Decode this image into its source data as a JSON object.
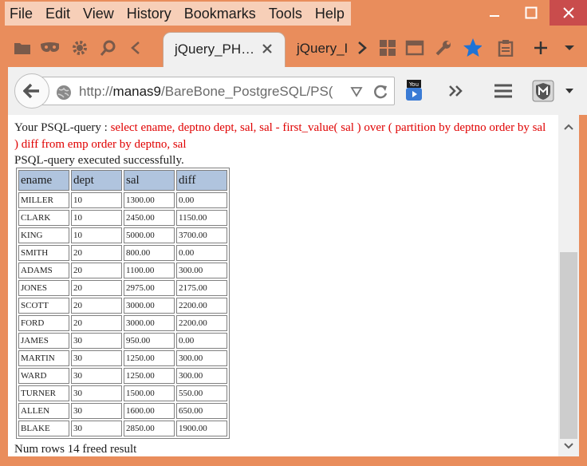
{
  "menu": {
    "items": [
      "File",
      "Edit",
      "View",
      "History",
      "Bookmarks",
      "Tools",
      "Help"
    ]
  },
  "tabs": {
    "active_title": "jQuery_PH…",
    "inactive_title": "jQuery_I"
  },
  "navbar": {
    "url_prefix": "http://",
    "url_host": "manas9",
    "url_path": "/BareBone_PostgreSQL/PS("
  },
  "content": {
    "query_label": "Your PSQL-query : ",
    "query_sql": "select ename, deptno dept, sal, sal - first_value( sal ) over ( partition by deptno order by sal ) diff from emp order by deptno, sal",
    "status": "PSQL-query executed successfully.",
    "table": {
      "headers": [
        "ename",
        "dept",
        "sal",
        "diff"
      ],
      "rows": [
        [
          "MILLER",
          "10",
          "1300.00",
          "0.00"
        ],
        [
          "CLARK",
          "10",
          "2450.00",
          "1150.00"
        ],
        [
          "KING",
          "10",
          "5000.00",
          "3700.00"
        ],
        [
          "SMITH",
          "20",
          "800.00",
          "0.00"
        ],
        [
          "ADAMS",
          "20",
          "1100.00",
          "300.00"
        ],
        [
          "JONES",
          "20",
          "2975.00",
          "2175.00"
        ],
        [
          "SCOTT",
          "20",
          "3000.00",
          "2200.00"
        ],
        [
          "FORD",
          "20",
          "3000.00",
          "2200.00"
        ],
        [
          "JAMES",
          "30",
          "950.00",
          "0.00"
        ],
        [
          "MARTIN",
          "30",
          "1250.00",
          "300.00"
        ],
        [
          "WARD",
          "30",
          "1250.00",
          "300.00"
        ],
        [
          "TURNER",
          "30",
          "1500.00",
          "550.00"
        ],
        [
          "ALLEN",
          "30",
          "1600.00",
          "650.00"
        ],
        [
          "BLAKE",
          "30",
          "2850.00",
          "1900.00"
        ]
      ]
    },
    "footer": "Num rows 14 freed result"
  },
  "colors": {
    "titlebar": "#e98d5c",
    "sql_text": "#e00000",
    "table_header": "#b0c4de",
    "close_button": "#c94c4c"
  }
}
